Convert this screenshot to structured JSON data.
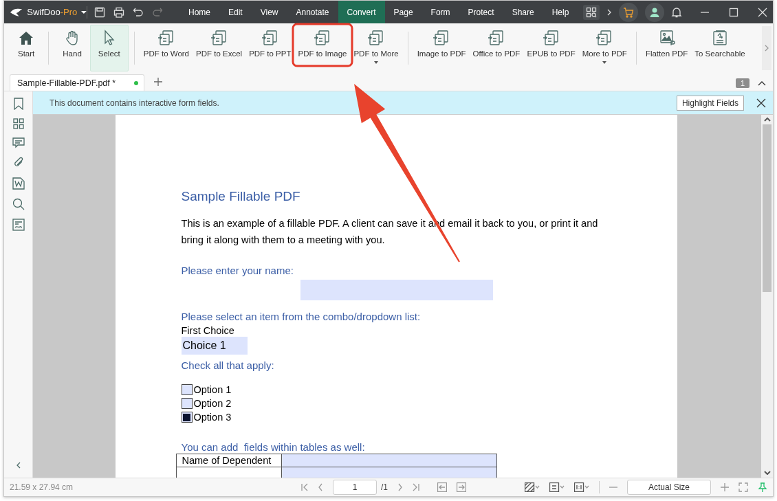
{
  "app": {
    "name": "SwifDoo",
    "edition": "-Pro"
  },
  "menu": [
    {
      "label": "Home",
      "selected": false
    },
    {
      "label": "Edit",
      "selected": false
    },
    {
      "label": "View",
      "selected": false
    },
    {
      "label": "Annotate",
      "selected": false
    },
    {
      "label": "Convert",
      "selected": true
    },
    {
      "label": "Page",
      "selected": false
    },
    {
      "label": "Form",
      "selected": false
    },
    {
      "label": "Protect",
      "selected": false
    },
    {
      "label": "Share",
      "selected": false
    },
    {
      "label": "Help",
      "selected": false
    }
  ],
  "ribbon_groups": [
    {
      "items": [
        {
          "label": "Start",
          "kind": "start",
          "selected": false,
          "dropdown": false
        }
      ]
    },
    {
      "items": [
        {
          "label": "Hand",
          "kind": "hand",
          "selected": false,
          "dropdown": false
        },
        {
          "label": "Select",
          "kind": "select",
          "selected": true,
          "dropdown": false
        }
      ]
    },
    {
      "items": [
        {
          "label": "PDF to Word",
          "kind": "convert",
          "selected": false,
          "dropdown": false
        },
        {
          "label": "PDF to Excel",
          "kind": "convert",
          "selected": false,
          "dropdown": false
        },
        {
          "label": "PDF to PPT",
          "kind": "convert",
          "selected": false,
          "dropdown": false
        },
        {
          "label": "PDF to Image",
          "kind": "convert",
          "selected": false,
          "dropdown": false
        },
        {
          "label": "PDF to More",
          "kind": "convert",
          "selected": false,
          "dropdown": true
        }
      ]
    },
    {
      "items": [
        {
          "label": "Image to PDF",
          "kind": "convert",
          "selected": false,
          "dropdown": false
        },
        {
          "label": "Office to PDF",
          "kind": "convert",
          "selected": false,
          "dropdown": false
        },
        {
          "label": "EPUB to PDF",
          "kind": "convert",
          "selected": false,
          "dropdown": false
        },
        {
          "label": "More to PDF",
          "kind": "convert",
          "selected": false,
          "dropdown": true
        }
      ]
    },
    {
      "items": [
        {
          "label": "Flatten PDF",
          "kind": "flatten",
          "selected": false,
          "dropdown": false
        },
        {
          "label": "To Searchable",
          "kind": "searchable",
          "selected": false,
          "dropdown": false
        }
      ]
    }
  ],
  "tabs": [
    {
      "title": "Sample-Fillable-PDF.pdf *",
      "selected": true
    }
  ],
  "tab_count": "1",
  "notice": {
    "text": "This document contains interactive form fields.",
    "button": "Highlight Fields"
  },
  "document": {
    "title": "Sample Fillable PDF",
    "paragraph": "This is an example of a fillable PDF. A client can save it and email it back to you, or print it and bring it along with them to a meeting with you.",
    "name_prompt": "Please enter your name:",
    "combo_prompt": "Please select an item from the combo/dropdown list:",
    "combo_label": "First Choice",
    "combo_value": "Choice 1",
    "check_prompt": "Check all that apply:",
    "options": [
      {
        "label": "Option 1",
        "checked": false
      },
      {
        "label": "Option 2",
        "checked": false
      },
      {
        "label": "Option 3",
        "checked": true
      }
    ],
    "table_prompt": "You can add  fields within tables as well:",
    "table_rows": [
      {
        "label": "Name of Dependent"
      },
      {
        "label": ""
      }
    ]
  },
  "status": {
    "size": "21.59 x 27.94 cm",
    "page": "1",
    "page_total": "/1",
    "zoom": "Actual Size"
  }
}
